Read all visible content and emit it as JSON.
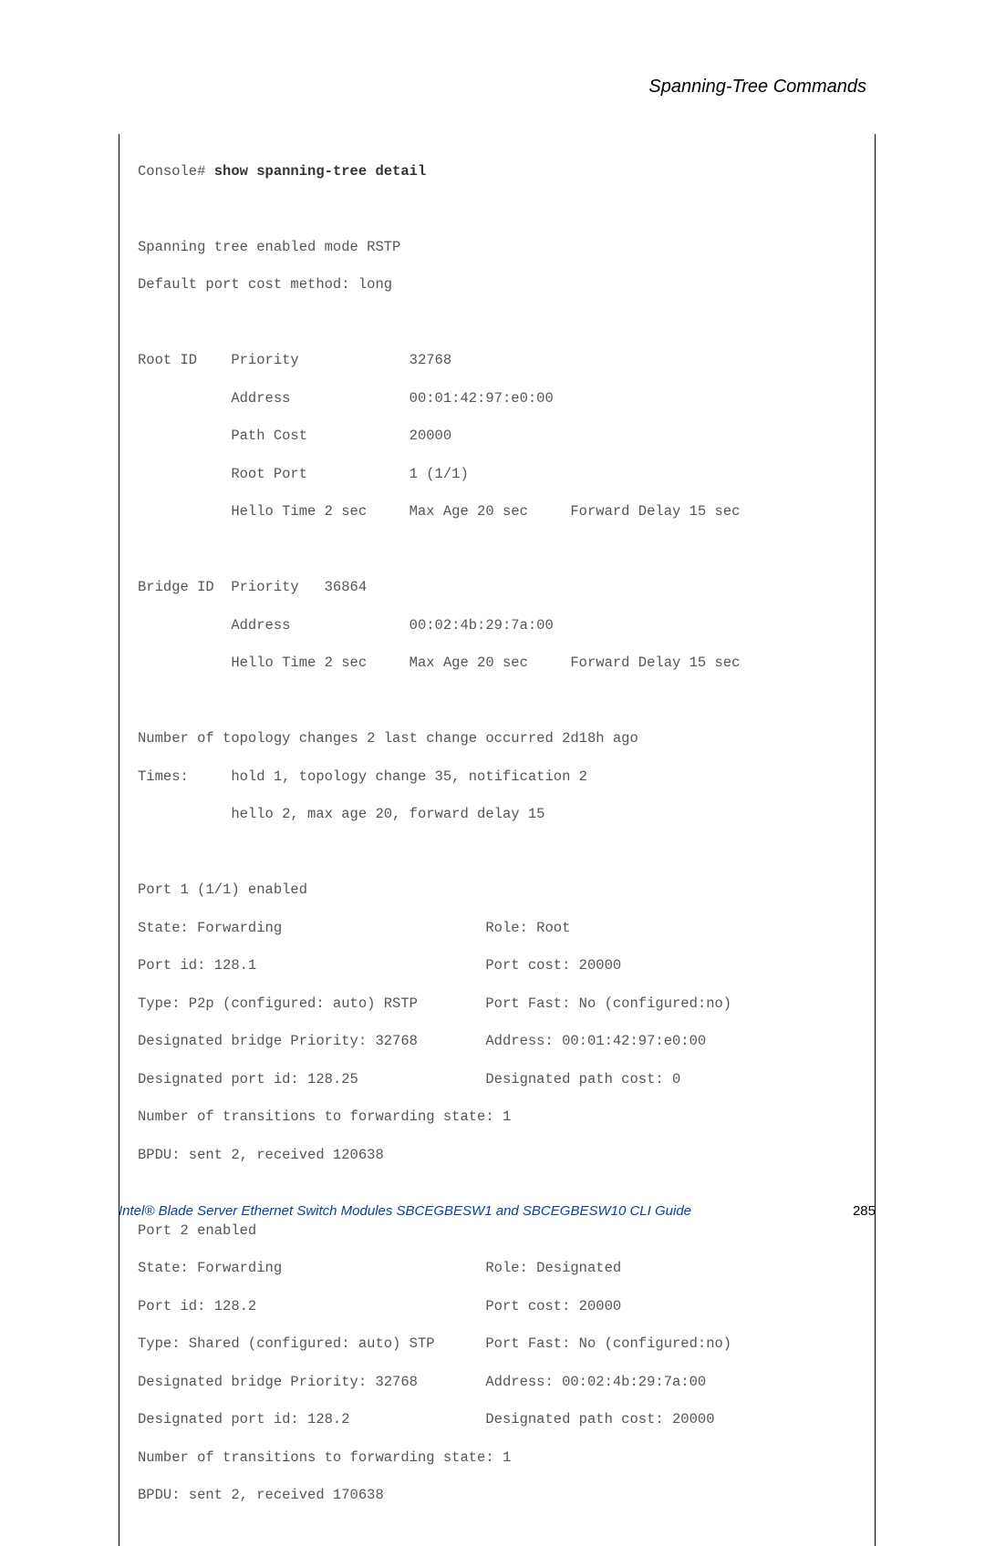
{
  "header": {
    "section_title": "Spanning-Tree Commands"
  },
  "console": {
    "prompt": "Console# ",
    "command": "show spanning-tree detail",
    "lines": [
      "",
      "Spanning tree enabled mode RSTP",
      "Default port cost method: long",
      "",
      "Root ID    Priority             32768",
      "           Address              00:01:42:97:e0:00",
      "           Path Cost            20000",
      "           Root Port            1 (1/1)",
      "           Hello Time 2 sec     Max Age 20 sec     Forward Delay 15 sec",
      "",
      "Bridge ID  Priority   36864",
      "           Address              00:02:4b:29:7a:00",
      "           Hello Time 2 sec     Max Age 20 sec     Forward Delay 15 sec",
      "",
      "Number of topology changes 2 last change occurred 2d18h ago",
      "Times:     hold 1, topology change 35, notification 2",
      "           hello 2, max age 20, forward delay 15",
      "",
      "Port 1 (1/1) enabled",
      "State: Forwarding                        Role: Root",
      "Port id: 128.1                           Port cost: 20000",
      "Type: P2p (configured: auto) RSTP        Port Fast: No (configured:no)",
      "Designated bridge Priority: 32768        Address: 00:01:42:97:e0:00",
      "Designated port id: 128.25               Designated path cost: 0",
      "Number of transitions to forwarding state: 1",
      "BPDU: sent 2, received 120638",
      "",
      "Port 2 enabled",
      "State: Forwarding                        Role: Designated",
      "Port id: 128.2                           Port cost: 20000",
      "Type: Shared (configured: auto) STP      Port Fast: No (configured:no)",
      "Designated bridge Priority: 32768        Address: 00:02:4b:29:7a:00",
      "Designated port id: 128.2                Designated path cost: 20000",
      "Number of transitions to forwarding state: 1",
      "BPDU: sent 2, received 170638"
    ]
  },
  "footer": {
    "doc_title": "Intel® Blade Server Ethernet Switch Modules SBCEGBESW1 and SBCEGBESW10 CLI Guide",
    "page_number": "285"
  }
}
